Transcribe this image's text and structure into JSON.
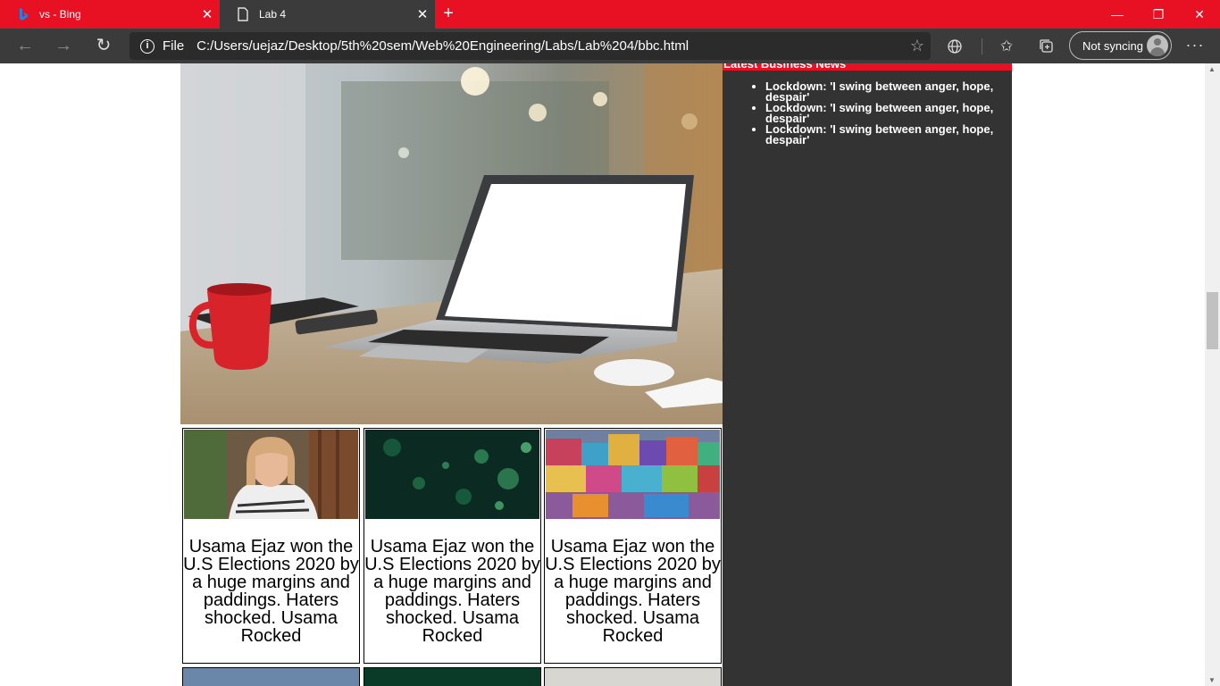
{
  "tabs": [
    {
      "title": "vs - Bing",
      "icon": "bing-icon",
      "active": false
    },
    {
      "title": "Lab 4",
      "icon": "page-icon",
      "active": true
    }
  ],
  "window_controls": {
    "minimize": "—",
    "restore": "❐",
    "close": "✕"
  },
  "address_bar": {
    "scheme_label": "File",
    "url": "C:/Users/uejaz/Desktop/5th%20sem/Web%20Engineering/Labs/Lab%204/bbc.html"
  },
  "profile": {
    "label": "Not syncing"
  },
  "sidebar": {
    "heading": "Latest Business News",
    "items": [
      "Lockdown: 'I swing between anger, hope, despair'",
      "Lockdown: 'I swing between anger, hope, despair'",
      "Lockdown: 'I swing between anger, hope, despair'"
    ]
  },
  "cards": [
    {
      "caption": "Usama Ejaz won the U.S Elections 2020 by a huge margins and paddings. Haters shocked. Usama Rocked",
      "image": "woman-portrait"
    },
    {
      "caption": "Usama Ejaz won the U.S Elections 2020 by a huge margins and paddings. Haters shocked. Usama Rocked",
      "image": "green-bokeh"
    },
    {
      "caption": "Usama Ejaz won the U.S Elections 2020 by a huge margins and paddings. Haters shocked. Usama Rocked",
      "image": "colorful-houses"
    }
  ],
  "colors": {
    "brand_red": "#e81123",
    "chrome_dark": "#3b3b3b",
    "sidebar_bg": "#333333"
  }
}
